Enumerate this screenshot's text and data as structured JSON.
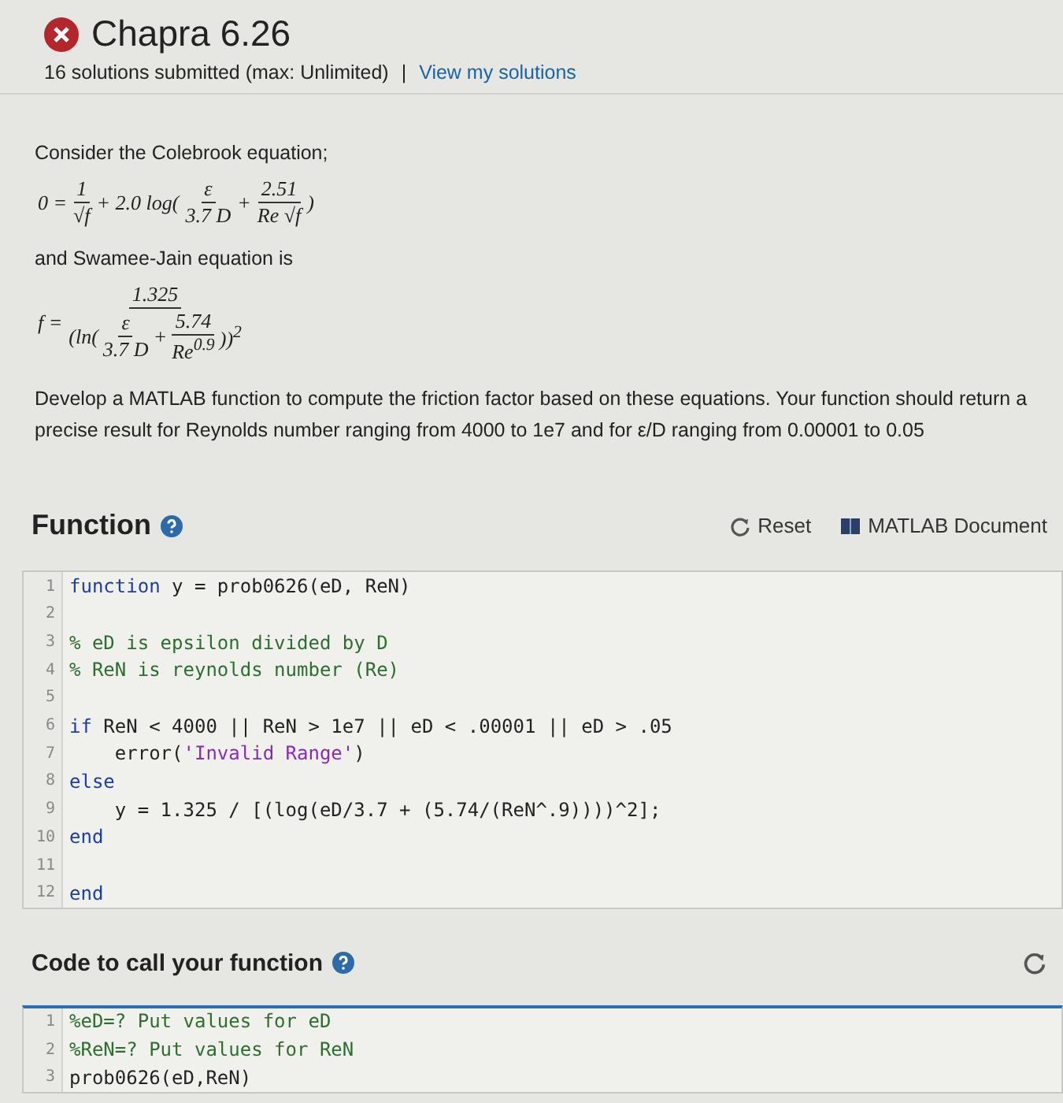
{
  "header": {
    "title": "Chapra 6.26",
    "solved": false,
    "submissions": "16 solutions submitted (max: Unlimited)",
    "separator": "|",
    "link": "View my solutions"
  },
  "problem": {
    "intro": "Consider the Colebrook equation;",
    "equation_1": [
      {
        "kind": "text",
        "text": "0 ="
      },
      {
        "kind": "frac",
        "num": [
          {
            "kind": "text",
            "text": "1"
          }
        ],
        "den": [
          {
            "kind": "text",
            "text": "√f"
          }
        ]
      },
      {
        "kind": "text",
        "text": "+ 2.0  log("
      },
      {
        "kind": "frac",
        "num": [
          {
            "kind": "text",
            "text": "ε"
          }
        ],
        "den": [
          {
            "kind": "text",
            "text": "3.7 D"
          }
        ]
      },
      {
        "kind": "text",
        "text": "+"
      },
      {
        "kind": "frac",
        "num": [
          {
            "kind": "text",
            "text": "2.51"
          }
        ],
        "den": [
          {
            "kind": "text",
            "text": "Re √f"
          }
        ]
      },
      {
        "kind": "text",
        "text": ")"
      }
    ],
    "middle": "and Swamee-Jain equation is",
    "equation_2": [
      {
        "kind": "text",
        "text": "f ="
      },
      {
        "kind": "frac",
        "num": [
          {
            "kind": "text",
            "text": "1.325"
          }
        ],
        "den": [
          {
            "kind": "text",
            "text": "(ln("
          },
          {
            "kind": "frac",
            "num": [
              {
                "kind": "text",
                "text": "ε"
              }
            ],
            "den": [
              {
                "kind": "text",
                "text": "3.7 D"
              }
            ]
          },
          {
            "kind": "text",
            "text": "+"
          },
          {
            "kind": "frac",
            "num": [
              {
                "kind": "text",
                "text": "5.74"
              }
            ],
            "den": [
              {
                "kind": "text",
                "text": "Re$^{0.9}$"
              }
            ]
          },
          {
            "kind": "text",
            "text": "))$^{2}$"
          }
        ]
      }
    ],
    "task": "Develop a MATLAB function to compute the friction factor based on these equations. Your function should return a precise result for Reynolds number ranging from 4000 to 1e7 and for ε/D ranging from 0.00001 to 0.05"
  },
  "function_section": {
    "heading": "Function",
    "reset": "Reset",
    "docs": "MATLAB Document",
    "lines": [
      {
        "number": "1",
        "tokens": [
          {
            "kind": "keyword",
            "text": "function"
          },
          {
            "kind": "plain",
            "text": " y = prob0626(eD, ReN)"
          }
        ]
      },
      {
        "number": "2"
      },
      {
        "number": "3",
        "tokens": [
          {
            "kind": "comment",
            "text": "% eD is epsilon divided by D"
          }
        ]
      },
      {
        "number": "4",
        "tokens": [
          {
            "kind": "comment",
            "text": "% ReN is reynolds number (Re)"
          }
        ]
      },
      {
        "number": "5"
      },
      {
        "number": "6",
        "tokens": [
          {
            "kind": "keyword",
            "text": "if"
          },
          {
            "kind": "plain",
            "text": " ReN < 4000 || ReN > 1e7 || eD < .00001 || eD > .05"
          }
        ]
      },
      {
        "number": "7",
        "tokens": [
          {
            "kind": "plain",
            "text": "    error("
          },
          {
            "kind": "string",
            "text": "'Invalid Range'"
          },
          {
            "kind": "plain",
            "text": ")"
          }
        ]
      },
      {
        "number": "8",
        "tokens": [
          {
            "kind": "keyword",
            "text": "else"
          }
        ]
      },
      {
        "number": "9",
        "tokens": [
          {
            "kind": "plain",
            "text": "    y = 1.325 / [(log(eD/3.7 + (5.74/(ReN^.9))))^2];"
          }
        ]
      },
      {
        "number": "10",
        "tokens": [
          {
            "kind": "keyword",
            "text": "end"
          }
        ]
      },
      {
        "number": "11"
      },
      {
        "number": "12",
        "tokens": [
          {
            "kind": "keyword",
            "text": "end"
          }
        ]
      }
    ]
  },
  "call_section": {
    "heading": "Code to call your function",
    "focused": true,
    "lines": [
      {
        "number": "1",
        "tokens": [
          {
            "kind": "comment",
            "text": "%eD=? Put values for eD"
          }
        ]
      },
      {
        "number": "2",
        "tokens": [
          {
            "kind": "comment",
            "text": "%ReN=? Put values for ReN"
          }
        ]
      },
      {
        "number": "3",
        "tokens": [
          {
            "kind": "plain",
            "text": "prob0626(eD,ReN)"
          }
        ]
      }
    ]
  }
}
